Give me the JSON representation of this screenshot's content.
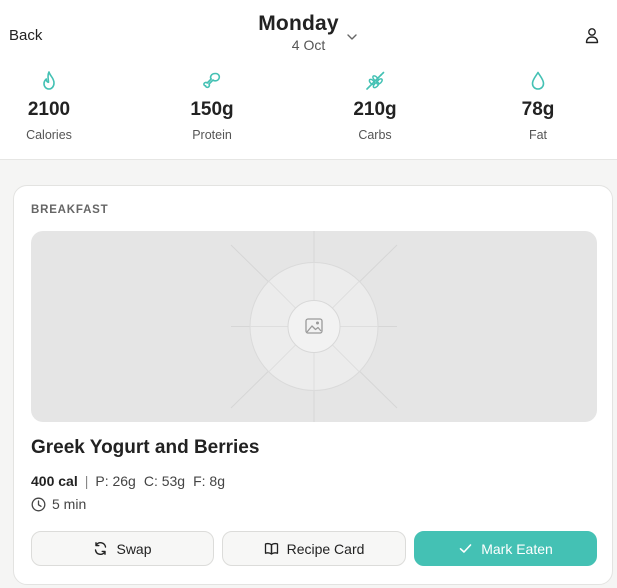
{
  "header": {
    "back_label": "Back",
    "day": "Monday",
    "date": "4 Oct",
    "icons": {
      "expand": "chevron-down-icon",
      "profile": "user-icon"
    }
  },
  "macros": [
    {
      "icon": "flame-icon",
      "value": "2100",
      "label": "Calories"
    },
    {
      "icon": "drumstick-icon",
      "value": "150g",
      "label": "Protein"
    },
    {
      "icon": "wheat-icon",
      "value": "210g",
      "label": "Carbs"
    },
    {
      "icon": "droplet-icon",
      "value": "78g",
      "label": "Fat"
    }
  ],
  "meal": {
    "type": "BREAKFAST",
    "image_icon": "image-icon",
    "title": "Greek Yogurt and Berries",
    "calories": "400 cal",
    "separator": "|",
    "protein": "P: 26g",
    "carbs": "C: 53g",
    "fat": "F: 8g",
    "time": "5 min"
  },
  "actions": {
    "swap": "Swap",
    "recipe": "Recipe Card",
    "mark_eaten": "Mark Eaten"
  },
  "colors": {
    "accent": "#44c1b4",
    "background": "#f5f5f4",
    "card": "#ffffff",
    "placeholder": "#e5e5e5"
  }
}
